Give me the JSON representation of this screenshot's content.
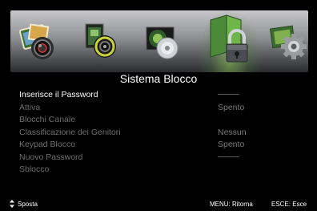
{
  "icons": [
    {
      "name": "photo-camera-icon",
      "label": ""
    },
    {
      "name": "video-film-icon",
      "label": ""
    },
    {
      "name": "music-disc-icon",
      "label": ""
    },
    {
      "name": "lock-icon",
      "label": ""
    },
    {
      "name": "settings-gear-icon",
      "label": ""
    }
  ],
  "menu": {
    "title": "Sistema Blocco",
    "items": [
      {
        "label": "Inserisce il Password",
        "value": ""
      },
      {
        "label": "Attiva",
        "value": "Spento"
      },
      {
        "label": "Blocchi Canale",
        "value": ""
      },
      {
        "label": "Classificazione dei Genitori",
        "value": "Nessun"
      },
      {
        "label": "Keypad Blocco",
        "value": "Spento"
      },
      {
        "label": "Nuovo Password",
        "value": ""
      },
      {
        "label": "Sblocco",
        "value": ""
      }
    ]
  },
  "footer": {
    "move_label": "Sposta",
    "menu_hint": "MENU: Ritorna",
    "exit_hint": "ESCE: Esce"
  },
  "colors": {
    "accent_active": "#8fcf5a",
    "text_primary": "#ffffff",
    "text_dim": "#6d6d6d"
  }
}
